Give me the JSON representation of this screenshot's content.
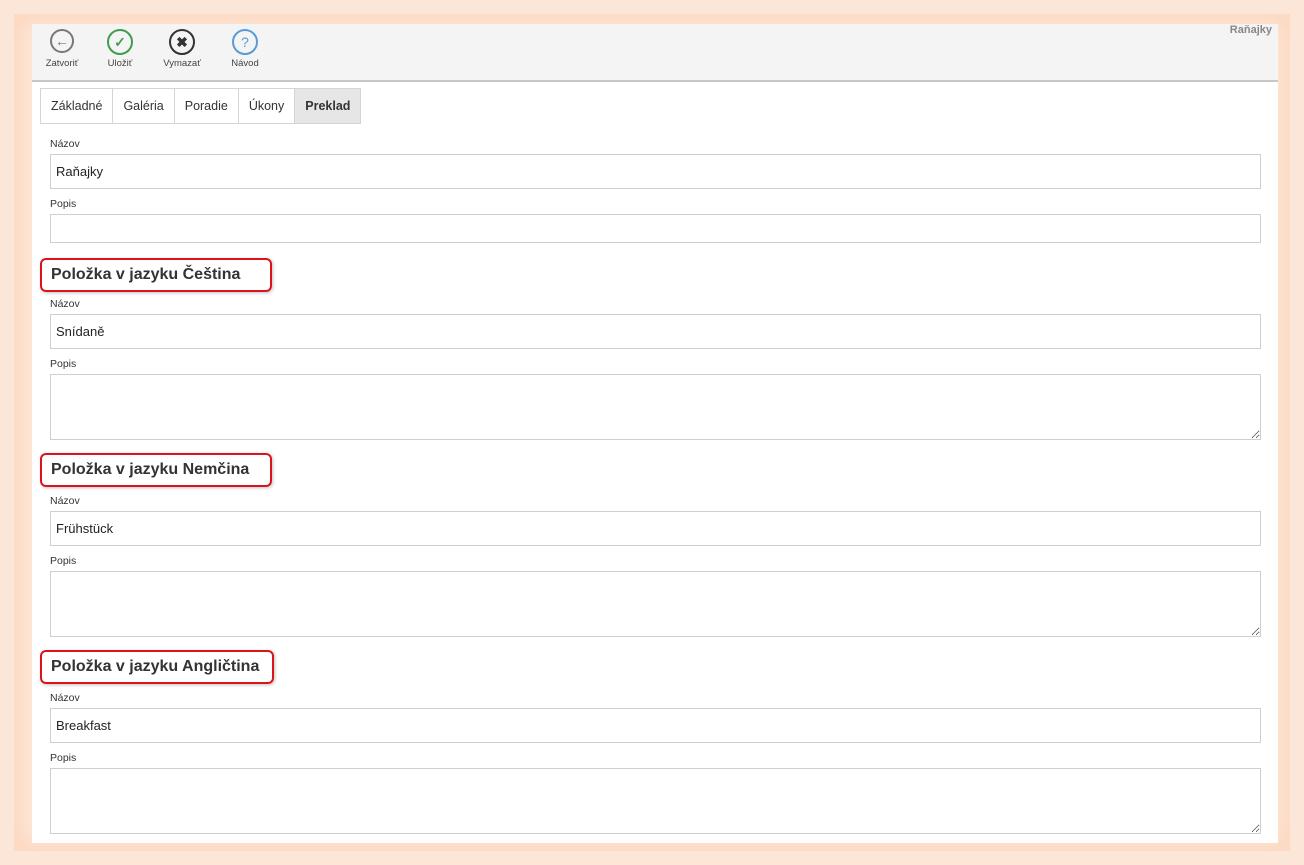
{
  "window_title": "Raňajky",
  "toolbar": {
    "close_label": "Zatvoriť",
    "save_label": "Uložiť",
    "delete_label": "Vymazať",
    "help_label": "Návod"
  },
  "tabs": [
    {
      "label": "Základné"
    },
    {
      "label": "Galéria"
    },
    {
      "label": "Poradie"
    },
    {
      "label": "Úkony"
    },
    {
      "label": "Preklad",
      "active": true
    }
  ],
  "default_lang": {
    "name_label": "Názov",
    "name_value": "Raňajky",
    "desc_label": "Popis",
    "desc_value": ""
  },
  "translations": [
    {
      "title": "Položka v jazyku Čeština",
      "name_label": "Názov",
      "name_value": "Snídaně",
      "desc_label": "Popis",
      "desc_value": ""
    },
    {
      "title": "Položka v jazyku Nemčina",
      "name_label": "Názov",
      "name_value": "Frühstück",
      "desc_label": "Popis",
      "desc_value": ""
    },
    {
      "title": "Položka v jazyku Angličtina",
      "name_label": "Názov",
      "name_value": "Breakfast",
      "desc_label": "Popis",
      "desc_value": ""
    }
  ],
  "colors": {
    "save_icon": "#3f9d4d",
    "close_icon": "#777777",
    "delete_icon": "#333333",
    "help_icon": "#5a9bd5",
    "highlight": "#d9141b"
  }
}
